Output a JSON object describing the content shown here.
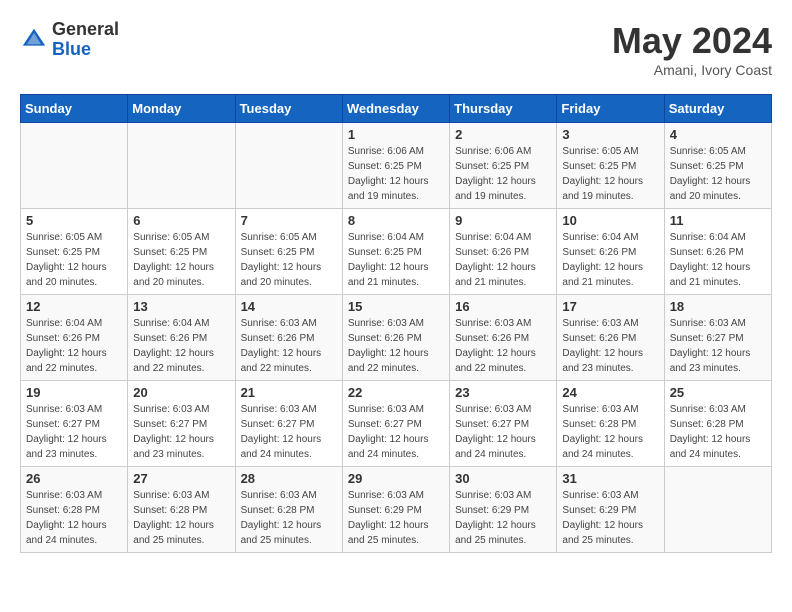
{
  "logo": {
    "general": "General",
    "blue": "Blue"
  },
  "title": "May 2024",
  "subtitle": "Amani, Ivory Coast",
  "days_of_week": [
    "Sunday",
    "Monday",
    "Tuesday",
    "Wednesday",
    "Thursday",
    "Friday",
    "Saturday"
  ],
  "weeks": [
    [
      {
        "num": "",
        "info": ""
      },
      {
        "num": "",
        "info": ""
      },
      {
        "num": "",
        "info": ""
      },
      {
        "num": "1",
        "info": "Sunrise: 6:06 AM\nSunset: 6:25 PM\nDaylight: 12 hours\nand 19 minutes."
      },
      {
        "num": "2",
        "info": "Sunrise: 6:06 AM\nSunset: 6:25 PM\nDaylight: 12 hours\nand 19 minutes."
      },
      {
        "num": "3",
        "info": "Sunrise: 6:05 AM\nSunset: 6:25 PM\nDaylight: 12 hours\nand 19 minutes."
      },
      {
        "num": "4",
        "info": "Sunrise: 6:05 AM\nSunset: 6:25 PM\nDaylight: 12 hours\nand 20 minutes."
      }
    ],
    [
      {
        "num": "5",
        "info": "Sunrise: 6:05 AM\nSunset: 6:25 PM\nDaylight: 12 hours\nand 20 minutes."
      },
      {
        "num": "6",
        "info": "Sunrise: 6:05 AM\nSunset: 6:25 PM\nDaylight: 12 hours\nand 20 minutes."
      },
      {
        "num": "7",
        "info": "Sunrise: 6:05 AM\nSunset: 6:25 PM\nDaylight: 12 hours\nand 20 minutes."
      },
      {
        "num": "8",
        "info": "Sunrise: 6:04 AM\nSunset: 6:25 PM\nDaylight: 12 hours\nand 21 minutes."
      },
      {
        "num": "9",
        "info": "Sunrise: 6:04 AM\nSunset: 6:26 PM\nDaylight: 12 hours\nand 21 minutes."
      },
      {
        "num": "10",
        "info": "Sunrise: 6:04 AM\nSunset: 6:26 PM\nDaylight: 12 hours\nand 21 minutes."
      },
      {
        "num": "11",
        "info": "Sunrise: 6:04 AM\nSunset: 6:26 PM\nDaylight: 12 hours\nand 21 minutes."
      }
    ],
    [
      {
        "num": "12",
        "info": "Sunrise: 6:04 AM\nSunset: 6:26 PM\nDaylight: 12 hours\nand 22 minutes."
      },
      {
        "num": "13",
        "info": "Sunrise: 6:04 AM\nSunset: 6:26 PM\nDaylight: 12 hours\nand 22 minutes."
      },
      {
        "num": "14",
        "info": "Sunrise: 6:03 AM\nSunset: 6:26 PM\nDaylight: 12 hours\nand 22 minutes."
      },
      {
        "num": "15",
        "info": "Sunrise: 6:03 AM\nSunset: 6:26 PM\nDaylight: 12 hours\nand 22 minutes."
      },
      {
        "num": "16",
        "info": "Sunrise: 6:03 AM\nSunset: 6:26 PM\nDaylight: 12 hours\nand 22 minutes."
      },
      {
        "num": "17",
        "info": "Sunrise: 6:03 AM\nSunset: 6:26 PM\nDaylight: 12 hours\nand 23 minutes."
      },
      {
        "num": "18",
        "info": "Sunrise: 6:03 AM\nSunset: 6:27 PM\nDaylight: 12 hours\nand 23 minutes."
      }
    ],
    [
      {
        "num": "19",
        "info": "Sunrise: 6:03 AM\nSunset: 6:27 PM\nDaylight: 12 hours\nand 23 minutes."
      },
      {
        "num": "20",
        "info": "Sunrise: 6:03 AM\nSunset: 6:27 PM\nDaylight: 12 hours\nand 23 minutes."
      },
      {
        "num": "21",
        "info": "Sunrise: 6:03 AM\nSunset: 6:27 PM\nDaylight: 12 hours\nand 24 minutes."
      },
      {
        "num": "22",
        "info": "Sunrise: 6:03 AM\nSunset: 6:27 PM\nDaylight: 12 hours\nand 24 minutes."
      },
      {
        "num": "23",
        "info": "Sunrise: 6:03 AM\nSunset: 6:27 PM\nDaylight: 12 hours\nand 24 minutes."
      },
      {
        "num": "24",
        "info": "Sunrise: 6:03 AM\nSunset: 6:28 PM\nDaylight: 12 hours\nand 24 minutes."
      },
      {
        "num": "25",
        "info": "Sunrise: 6:03 AM\nSunset: 6:28 PM\nDaylight: 12 hours\nand 24 minutes."
      }
    ],
    [
      {
        "num": "26",
        "info": "Sunrise: 6:03 AM\nSunset: 6:28 PM\nDaylight: 12 hours\nand 24 minutes."
      },
      {
        "num": "27",
        "info": "Sunrise: 6:03 AM\nSunset: 6:28 PM\nDaylight: 12 hours\nand 25 minutes."
      },
      {
        "num": "28",
        "info": "Sunrise: 6:03 AM\nSunset: 6:28 PM\nDaylight: 12 hours\nand 25 minutes."
      },
      {
        "num": "29",
        "info": "Sunrise: 6:03 AM\nSunset: 6:29 PM\nDaylight: 12 hours\nand 25 minutes."
      },
      {
        "num": "30",
        "info": "Sunrise: 6:03 AM\nSunset: 6:29 PM\nDaylight: 12 hours\nand 25 minutes."
      },
      {
        "num": "31",
        "info": "Sunrise: 6:03 AM\nSunset: 6:29 PM\nDaylight: 12 hours\nand 25 minutes."
      },
      {
        "num": "",
        "info": ""
      }
    ]
  ]
}
